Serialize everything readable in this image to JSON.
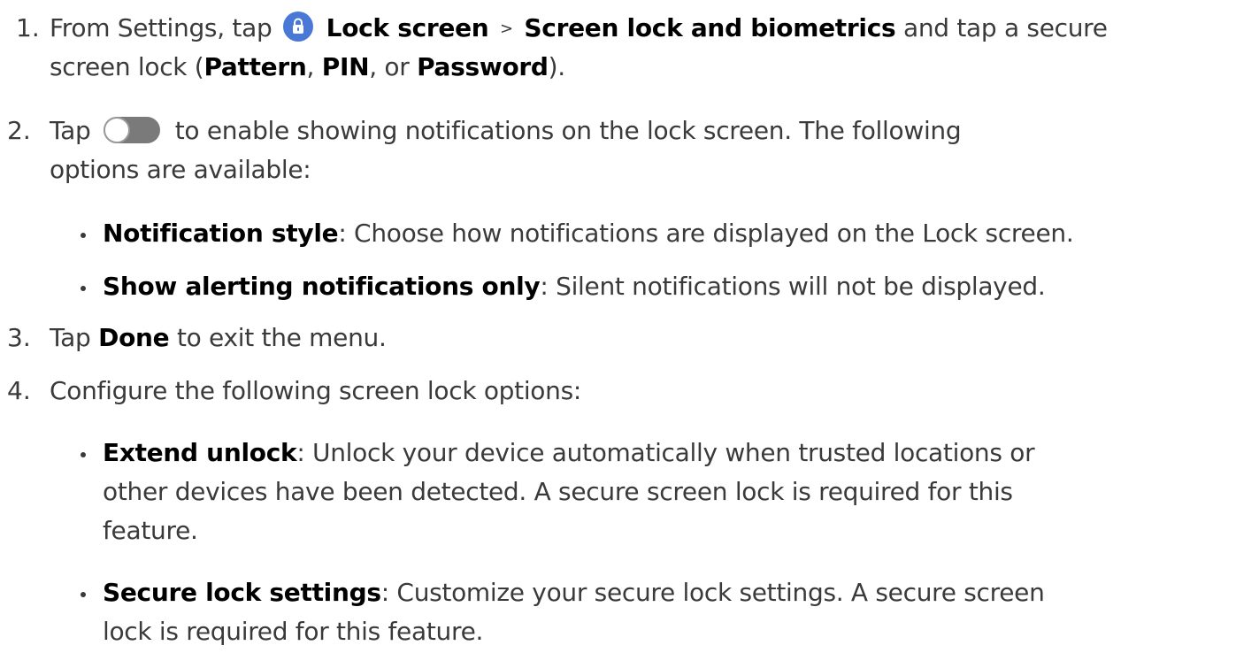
{
  "steps": [
    {
      "number": "1.",
      "prefix": "From Settings, tap",
      "lock_screen": "Lock screen",
      "separator": ">",
      "screen_lock_biometrics": "Screen lock and biometrics",
      "text_a": "and tap a secure",
      "text_b": "screen lock (",
      "pattern": "Pattern",
      "comma1": ",",
      "pin": "PIN",
      "text_c": ", or",
      "password": "Password",
      "text_d": ")."
    },
    {
      "number": "2.",
      "prefix": "Tap",
      "text_a": "to enable showing notifications on the lock screen. The following",
      "text_b": "options are available:",
      "bullets": [
        {
          "term": "Notification style",
          "desc": ": Choose how notifications are displayed on the Lock screen."
        },
        {
          "term": "Show alerting notifications only",
          "desc": ": Silent notifications will not be displayed."
        }
      ]
    },
    {
      "number": "3.",
      "prefix": "Tap",
      "done": "Done",
      "text_a": "to exit the menu."
    },
    {
      "number": "4.",
      "text_a": "Configure the following screen lock options:",
      "bullets": [
        {
          "term": "Extend unlock",
          "desc_1": ": Unlock your device automatically when trusted locations or",
          "desc_2": "other devices have been detected. A secure screen lock is required for this",
          "desc_3": "feature."
        },
        {
          "term": "Secure lock settings",
          "desc_1": ": Customize your secure lock settings. A secure screen",
          "desc_2": "lock is required for this feature."
        }
      ]
    }
  ],
  "icons": {
    "lock": "lock-icon",
    "toggle": "toggle-switch-icon",
    "lock_icon_color": "#4a78d6",
    "toggle_color": "#7a7a7a"
  }
}
